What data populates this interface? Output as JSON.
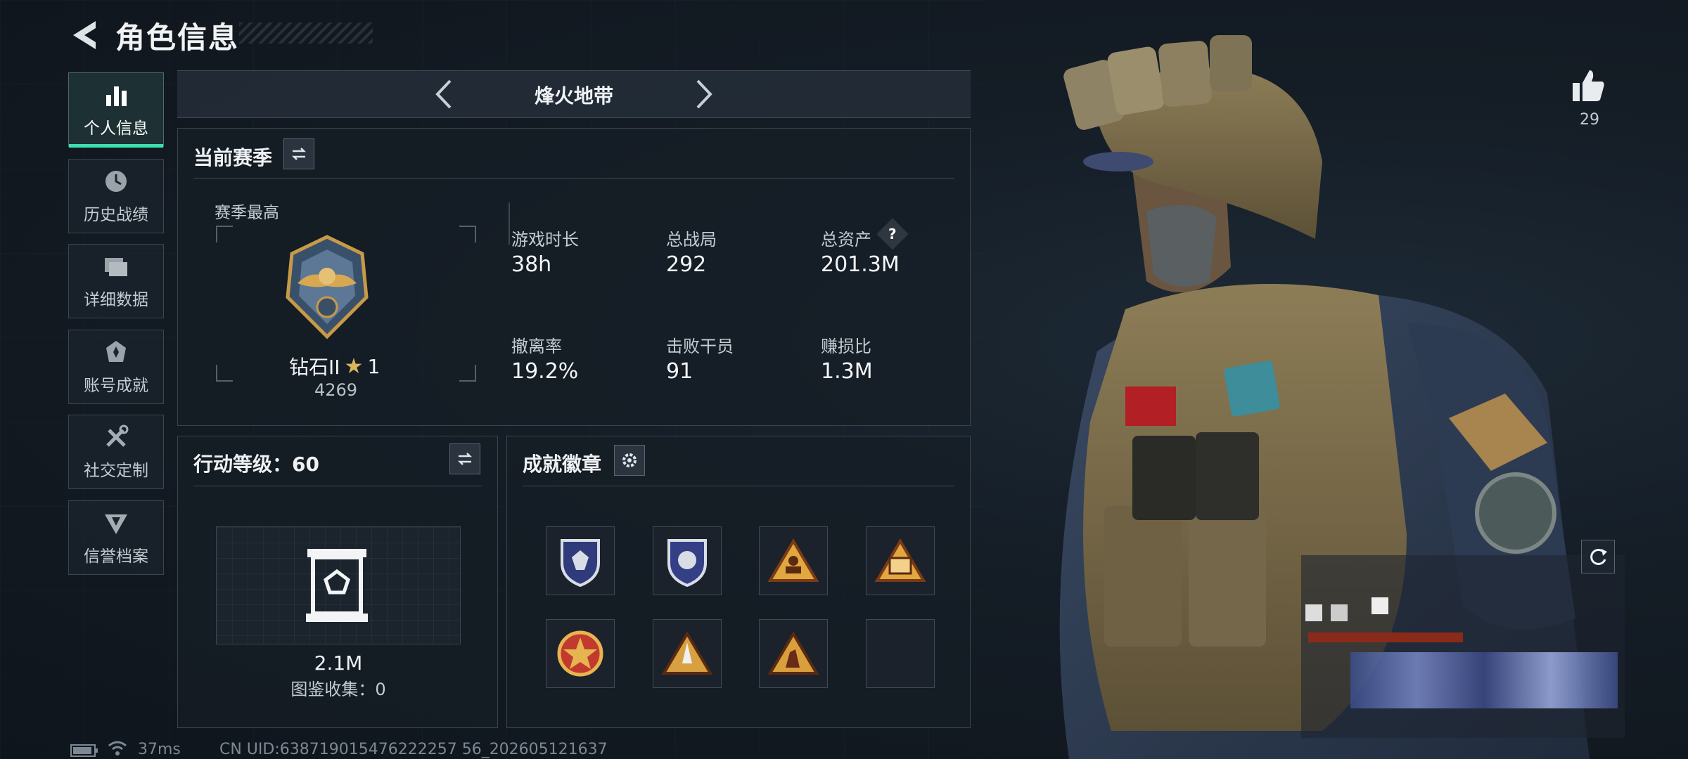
{
  "header": {
    "title": "角色信息"
  },
  "sidebar": {
    "items": [
      {
        "label": "个人信息",
        "icon": "bar-chart-icon",
        "active": true
      },
      {
        "label": "历史战绩",
        "icon": "history-clock-icon"
      },
      {
        "label": "详细数据",
        "icon": "folder-icon"
      },
      {
        "label": "账号成就",
        "icon": "achievement-icon"
      },
      {
        "label": "社交定制",
        "icon": "tools-icon"
      },
      {
        "label": "信誉档案",
        "icon": "reputation-icon"
      }
    ]
  },
  "mode_selector": {
    "current": "烽火地带"
  },
  "season": {
    "title": "当前赛季",
    "best_label": "赛季最高",
    "rank_name": "钻石II",
    "rank_stars": "1",
    "rank_score": "4269",
    "stats": [
      {
        "label": "游戏时长",
        "value": "38h"
      },
      {
        "label": "总战局",
        "value": "292"
      },
      {
        "label": "总资产",
        "value": "201.3M",
        "help": "?"
      },
      {
        "label": "撤离率",
        "value": "19.2%"
      },
      {
        "label": "击败干员",
        "value": "91"
      },
      {
        "label": "赚损比",
        "value": "1.3M"
      }
    ]
  },
  "action_level": {
    "title": "行动等级：60",
    "value": "2.1M",
    "collection": "图鉴收集：0"
  },
  "achievements": {
    "title": "成就徽章",
    "badges": [
      "shield-badge-1",
      "shield-badge-2",
      "triangle-runner-badge",
      "triangle-sb-badge",
      "star-medal-badge",
      "triangle-rocket-badge",
      "triangle-soldier-badge",
      "empty-slot"
    ]
  },
  "likes": {
    "count": "29"
  },
  "footer": {
    "ping": "37ms",
    "uid": "CN UID:638719015476222257 56_202605121637"
  },
  "colors": {
    "accent": "#3ee0b0",
    "panel_border": "#3a444e",
    "background": "#121a22"
  }
}
